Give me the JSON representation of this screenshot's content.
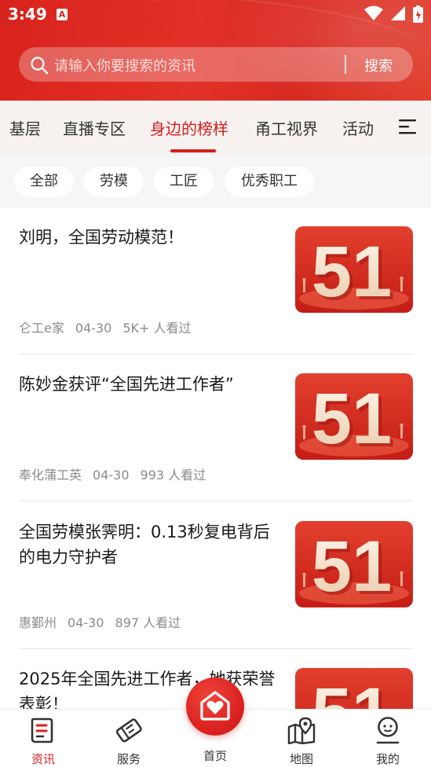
{
  "status_bar": {
    "time": "3:49",
    "notification_glyph": "A"
  },
  "search": {
    "placeholder": "请输入你要搜索的资讯",
    "button_label": "搜索"
  },
  "tabs": [
    {
      "label": "基层",
      "active": false
    },
    {
      "label": "直播专区",
      "active": false
    },
    {
      "label": "身边的榜样",
      "active": true
    },
    {
      "label": "甬工视界",
      "active": false
    },
    {
      "label": "活动",
      "active": false
    }
  ],
  "filters": [
    {
      "label": "全部"
    },
    {
      "label": "劳模"
    },
    {
      "label": "工匠"
    },
    {
      "label": "优秀职工"
    }
  ],
  "articles": [
    {
      "title": "刘明，全国劳动模范！",
      "source": "仑工e家",
      "date": "04-30",
      "views": "5K+ 人看过",
      "thumb_text": "51"
    },
    {
      "title": "陈妙金获评“全国先进工作者”",
      "source": "奉化蒲工英",
      "date": "04-30",
      "views": "993 人看过",
      "thumb_text": "51"
    },
    {
      "title": "全国劳模张霁明：0.13秒复电背后的电力守护者",
      "source": "惠鄞州",
      "date": "04-30",
      "views": "897 人看过",
      "thumb_text": "51"
    },
    {
      "title": "2025年全国先进工作者，她获荣誉表彰！",
      "source": "",
      "date": "",
      "views": "",
      "thumb_text": "51"
    }
  ],
  "bottom_nav": {
    "news": "资讯",
    "service": "服务",
    "home": "首页",
    "map": "地图",
    "mine": "我的"
  },
  "colors": {
    "brand_red": "#d81e1e",
    "header_red": "#dd2b23"
  }
}
